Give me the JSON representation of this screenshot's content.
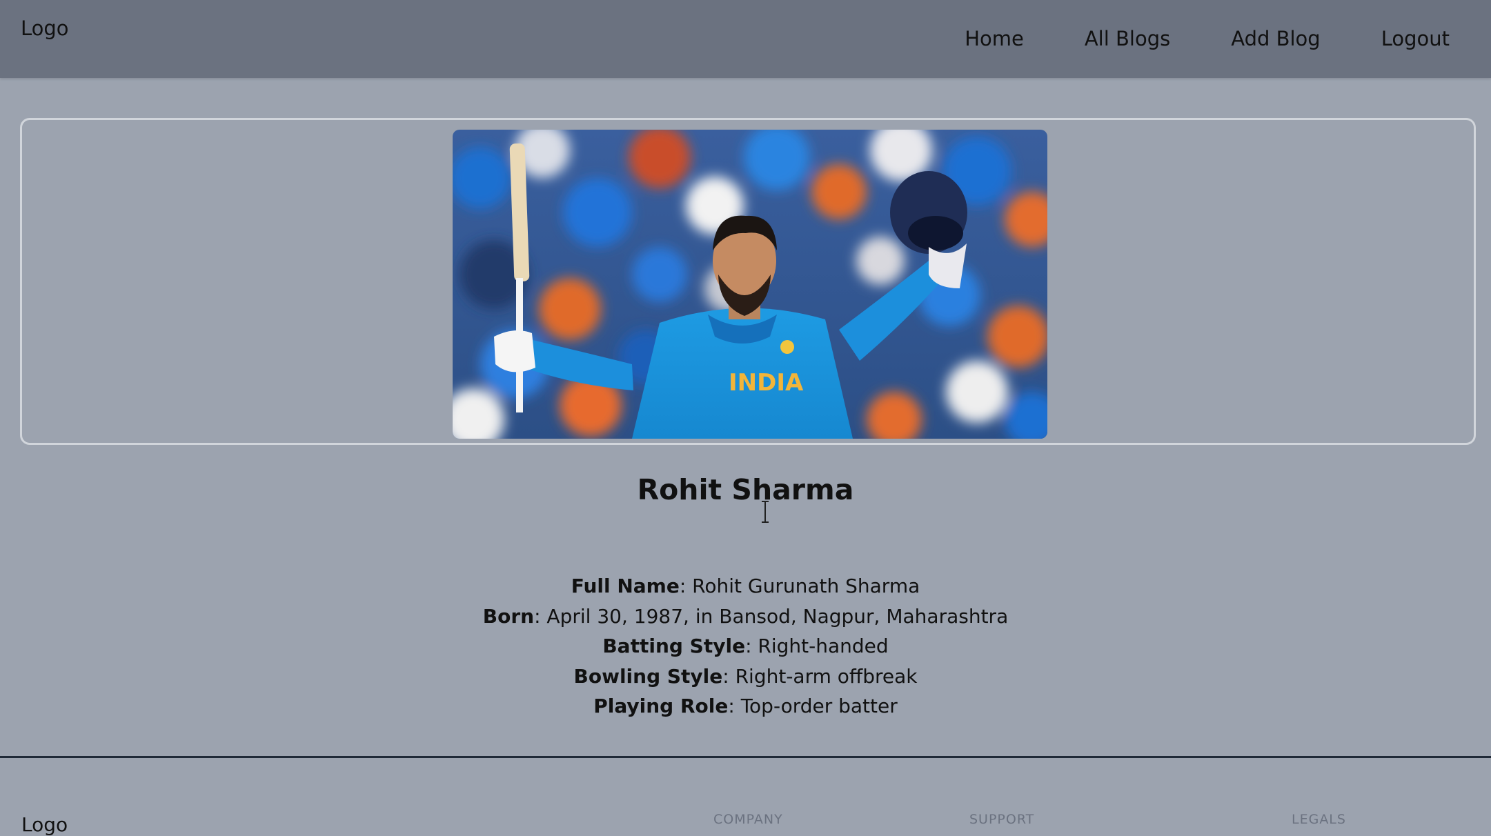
{
  "navbar": {
    "logo": "Logo",
    "links": [
      {
        "label": "Home"
      },
      {
        "label": "All Blogs"
      },
      {
        "label": "Add Blog"
      },
      {
        "label": "Logout"
      }
    ]
  },
  "post": {
    "image_text": "INDIA",
    "title": "Rohit Sharma",
    "details": [
      {
        "label": "Full Name",
        "value": ": Rohit Gurunath Sharma"
      },
      {
        "label": "Born",
        "value": ": April 30, 1987, in Bansod, Nagpur, Maharashtra"
      },
      {
        "label": "Batting Style",
        "value": ": Right-handed"
      },
      {
        "label": "Bowling Style",
        "value": ": Right-arm offbreak"
      },
      {
        "label": "Playing Role",
        "value": ": Top-order batter"
      }
    ]
  },
  "footer": {
    "logo": "Logo",
    "headings": [
      "COMPANY",
      "SUPPORT",
      "LEGALS"
    ]
  }
}
